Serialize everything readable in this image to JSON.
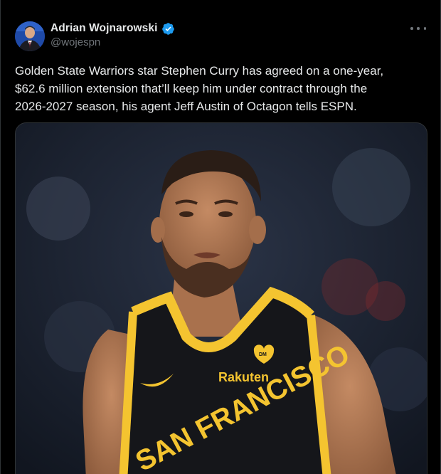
{
  "author": {
    "display_name": "Adrian Wojnarowski",
    "handle": "@wojespn",
    "verified": true,
    "avatar_icon": "profile-avatar"
  },
  "tweet": {
    "text": "Golden State Warriors star Stephen Curry has agreed on a one-year,\n$62.6 million extension that’ll keep him under contract through the\n2026-2027 season, his agent Jeff Austin of Octagon tells ESPN."
  },
  "media": {
    "jersey": {
      "sponsor": "Rakuten",
      "wordmark": "SAN FRANCISCO",
      "patch": "DM"
    }
  },
  "icons": {
    "more": "more-options-icon",
    "verified": "verified-badge-icon"
  },
  "colors": {
    "background": "#000000",
    "text_primary": "#e7e9ea",
    "text_secondary": "#71767b",
    "verified_blue": "#1d9bf0",
    "jersey_black": "#15161a",
    "jersey_gold": "#f4c430"
  }
}
